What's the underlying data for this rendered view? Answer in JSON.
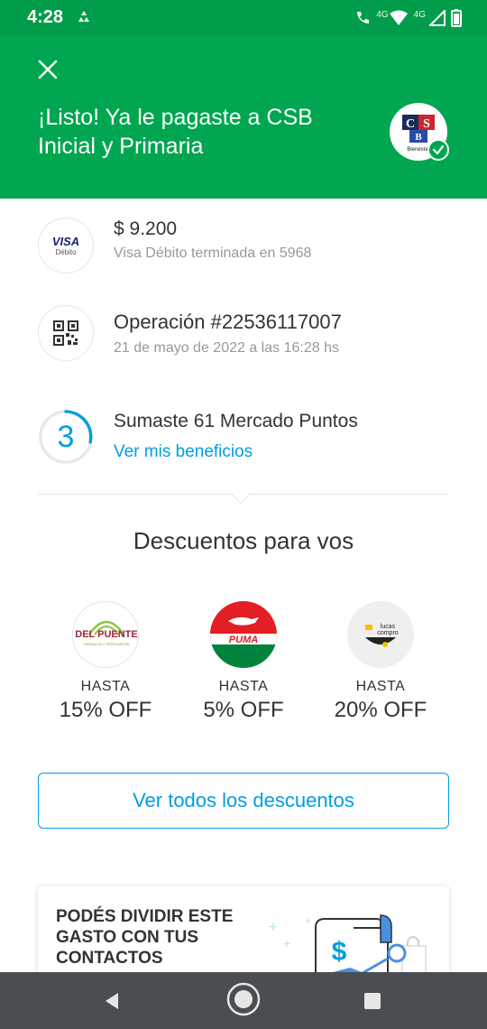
{
  "status_bar": {
    "time": "4:28",
    "network_label_1": "4G",
    "network_label_2": "4G"
  },
  "header": {
    "title": "¡Listo! Ya le pagaste a CSB Inicial y Primaria",
    "merchant_logo_text": "CS B",
    "merchant_logo_caption": "Bienestar"
  },
  "payment": {
    "card_brand": "VISA",
    "card_type": "Débito",
    "amount": "$ 9.200",
    "card_desc": "Visa Débito terminada en 5968"
  },
  "operation": {
    "title": "Operación #22536117007",
    "date": "21 de mayo de 2022 a las 16:28 hs"
  },
  "points": {
    "level": "3",
    "title": "Sumaste 61 Mercado Puntos",
    "link": "Ver mis beneficios"
  },
  "discounts": {
    "title": "Descuentos para vos",
    "items": [
      {
        "brand": "DEL PUENTE",
        "brand_sub": "FARMACIA Y PERFUMERÍA",
        "hasta": "HASTA",
        "off": "15% OFF"
      },
      {
        "brand": "PUMA",
        "hasta": "HASTA",
        "off": "5% OFF"
      },
      {
        "brand": "lucas compro",
        "hasta": "HASTA",
        "off": "20% OFF"
      }
    ],
    "all_button": "Ver todos los descuentos"
  },
  "split": {
    "text": "PODÉS DIVIDIR ESTE GASTO CON TUS CONTACTOS",
    "icon_symbol": "$"
  },
  "colors": {
    "header_green": "#00a650",
    "status_green": "#029d4a",
    "link_blue": "#009ee3",
    "nav_bg": "#4a4d52"
  }
}
